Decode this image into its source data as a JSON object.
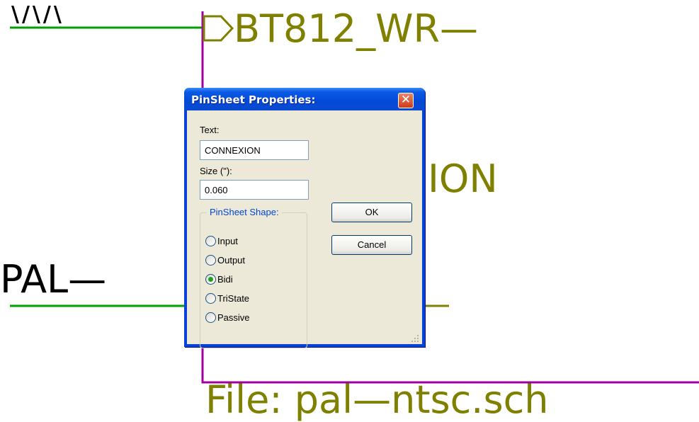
{
  "schematic": {
    "label_top_left": "\\/\\/\\",
    "label_bt812": "BT812_WR—",
    "label_partial_right": "ION",
    "label_pal": "PAL—",
    "footer_file": "File: pal—ntsc.sch",
    "wire_color": "#00a000",
    "bus_color": "#a000a0",
    "text_color": "#808000"
  },
  "dialog": {
    "title": "PinSheet Properties:",
    "close_glyph": "✕",
    "text_label": "Text:",
    "text_value": "CONNEXION",
    "size_label": "Size (\"):",
    "size_value": "0.060",
    "shape_group_label": "PinSheet Shape:",
    "shape_options": [
      {
        "label": "Input",
        "selected": false
      },
      {
        "label": "Output",
        "selected": false
      },
      {
        "label": "Bidi",
        "selected": true
      },
      {
        "label": "TriState",
        "selected": false
      },
      {
        "label": "Passive",
        "selected": false
      }
    ],
    "ok_label": "OK",
    "cancel_label": "Cancel"
  }
}
